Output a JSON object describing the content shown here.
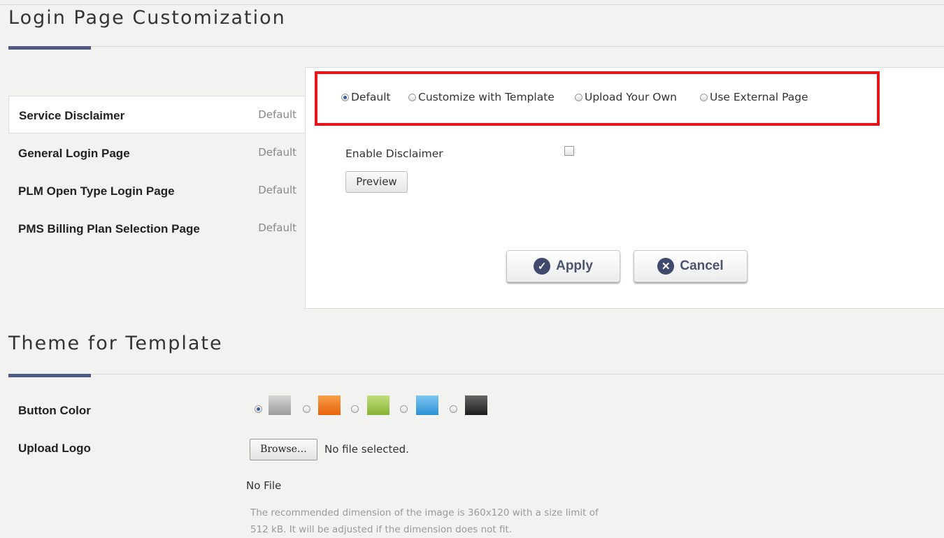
{
  "login_customization": {
    "title": "Login Page Customization",
    "menu": [
      {
        "label": "Service Disclaimer",
        "status": "Default",
        "active": true
      },
      {
        "label": "General Login Page",
        "status": "Default",
        "active": false
      },
      {
        "label": "PLM Open Type Login Page",
        "status": "Default",
        "active": false
      },
      {
        "label": "PMS Billing Plan Selection Page",
        "status": "Default",
        "active": false
      }
    ],
    "mode_options": [
      {
        "label": "Default",
        "selected": true
      },
      {
        "label": "Customize with Template",
        "selected": false
      },
      {
        "label": "Upload Your Own",
        "selected": false
      },
      {
        "label": "Use External Page",
        "selected": false
      }
    ],
    "enable_disclaimer_label": "Enable Disclaimer",
    "enable_disclaimer_checked": false,
    "preview_label": "Preview",
    "apply_label": "Apply",
    "cancel_label": "Cancel"
  },
  "theme": {
    "title": "Theme for Template",
    "button_color_label": "Button Color",
    "button_colors": [
      {
        "color": "#b8b8b8",
        "selected": true
      },
      {
        "color": "#f07a1a",
        "selected": false
      },
      {
        "color": "#9ec44a",
        "selected": false
      },
      {
        "color": "#3fa0dc",
        "selected": false
      },
      {
        "color": "#2e2e2e",
        "selected": false
      }
    ],
    "upload_logo_label": "Upload Logo",
    "browse_label": "Browse…",
    "file_status": "No file selected.",
    "no_file_label": "No File",
    "hint_line1": "The recommended dimension of the image is 360x120 with a size limit of",
    "hint_line2": "512 kB. It will be adjusted if the dimension does not fit."
  },
  "colors": {
    "accent": "#4f5b85",
    "highlight": "#e8141b"
  }
}
